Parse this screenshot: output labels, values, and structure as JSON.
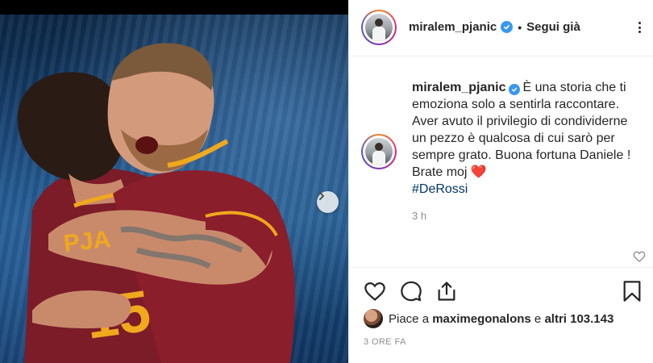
{
  "post": {
    "image_alt": "",
    "jersey_text": "PJA",
    "jersey_number": "15"
  },
  "header": {
    "username": "miralem_pjanic",
    "separator": "•",
    "follow_state": "Segui già"
  },
  "caption": {
    "username": "miralem_pjanic",
    "lines": [
      "È una storia che ti",
      "emoziona solo a sentirla raccontare.",
      "Aver avuto il privilegio di condividerne",
      "un pezzo è qualcosa di cui sarò per",
      "sempre grato. Buona fortuna Daniele !",
      "Brate moj"
    ],
    "heart": "❤️",
    "hashtag": "#DeRossi",
    "time": "3 h"
  },
  "likes": {
    "prefix": "Piace a ",
    "user": "maximegonalons",
    "middle": " e ",
    "others": "altri 103.143"
  },
  "date_label": "3 ORE FA",
  "colors": {
    "verified": "#3897f0",
    "hashtag": "#003569",
    "muted": "#8e8e8e",
    "jersey": "#8a1e2b",
    "jersey_trim": "#f0a81d"
  },
  "icons": {
    "next": "chevron-right-icon",
    "like": "heart-icon",
    "comment": "comment-icon",
    "share": "share-icon",
    "save": "bookmark-icon",
    "more": "more-icon",
    "verified": "verified-badge-icon"
  }
}
